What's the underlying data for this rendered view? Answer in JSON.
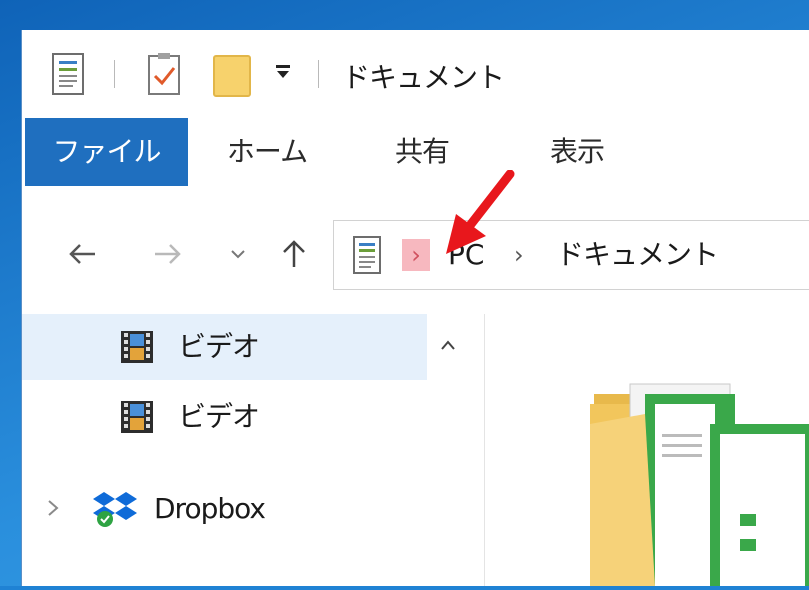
{
  "window": {
    "title": "ドキュメント"
  },
  "ribbon": {
    "tabs": [
      {
        "label": "ファイル"
      },
      {
        "label": "ホーム"
      },
      {
        "label": "共有"
      },
      {
        "label": "表示"
      }
    ]
  },
  "address": {
    "crumbs": [
      "PC",
      "ドキュメント"
    ],
    "separator": "›"
  },
  "navpane": {
    "items": [
      {
        "label": "ビデオ",
        "selected": true
      },
      {
        "label": "ビデオ",
        "selected": false
      },
      {
        "label": "Dropbox",
        "selected": false
      }
    ]
  },
  "colors": {
    "file_tab": "#1f6fbf",
    "highlight_separator": "#f7b8bf",
    "annotation_arrow": "#e8171c",
    "selected_item": "#e5f0fb"
  },
  "icons": [
    "document-icon",
    "checkmark-doc-icon",
    "folder-icon",
    "qat-dropdown-icon",
    "back-icon",
    "forward-icon",
    "recent-locations-icon",
    "up-icon",
    "video-library-icon",
    "dropbox-icon",
    "expand-chevron-icon",
    "scroll-up-icon",
    "folder-documents-large-icon"
  ]
}
